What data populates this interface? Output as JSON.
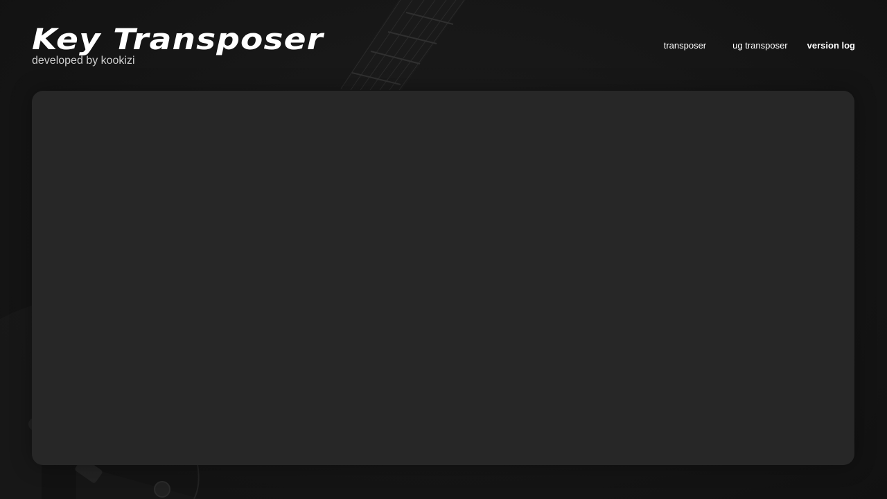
{
  "header": {
    "title": "Key Transposer",
    "subtitle": "developed by kookizi"
  },
  "nav": {
    "items": [
      {
        "label": "transposer"
      },
      {
        "label": "ug transposer"
      },
      {
        "label": "version log"
      }
    ],
    "active": "version log"
  },
  "main": {
    "panel_content": ""
  },
  "colors": {
    "background": "#151515",
    "panel": "#272727",
    "text": "#ffffff",
    "subtitle": "#cfcfcf"
  }
}
